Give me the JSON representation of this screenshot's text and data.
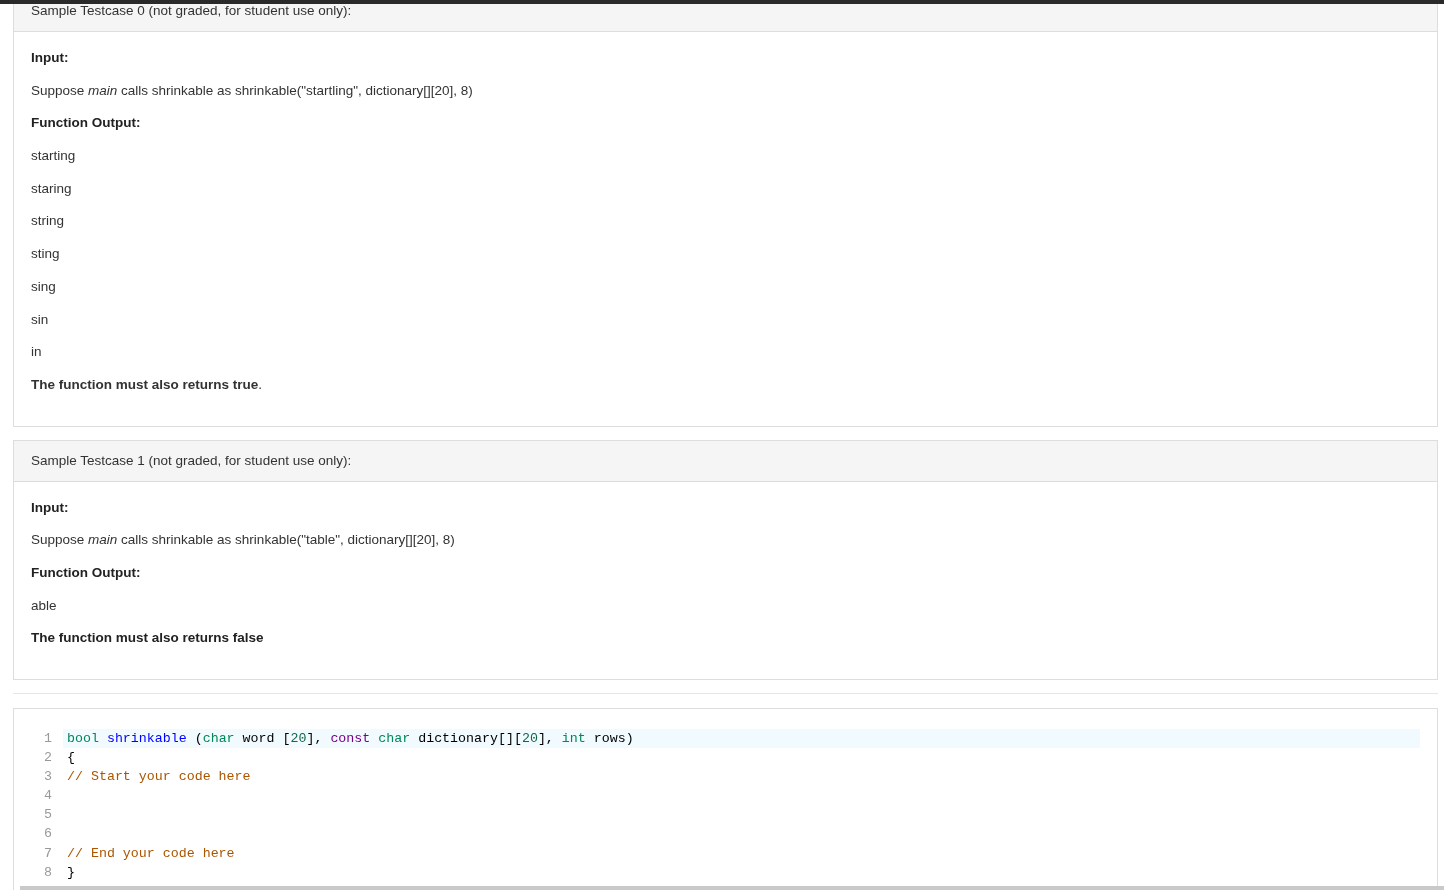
{
  "testcases": [
    {
      "title": "Sample Testcase 0 (not graded, for student use only):",
      "blocks": [
        {
          "kind": "label",
          "text": "Input:"
        },
        {
          "kind": "text",
          "text": "Suppose *main* calls shrinkable as shrinkable(\"startling\", dictionary[][20], 8)"
        },
        {
          "kind": "label",
          "text": "Function Output:"
        },
        {
          "kind": "output",
          "text": "starting"
        },
        {
          "kind": "output",
          "text": "staring"
        },
        {
          "kind": "output",
          "text": "string"
        },
        {
          "kind": "output",
          "text": "sting"
        },
        {
          "kind": "output",
          "text": "sing"
        },
        {
          "kind": "output",
          "text": "sin"
        },
        {
          "kind": "output",
          "text": "in"
        },
        {
          "kind": "text",
          "text": "**The function must also returns true**."
        }
      ]
    },
    {
      "title": "Sample Testcase 1 (not graded, for student use only):",
      "blocks": [
        {
          "kind": "label",
          "text": "Input:"
        },
        {
          "kind": "text",
          "text": "Suppose *main* calls shrinkable as shrinkable(\"table\", dictionary[][20], 8)"
        },
        {
          "kind": "label",
          "text": "Function Output:"
        },
        {
          "kind": "output",
          "text": "able"
        },
        {
          "kind": "statement",
          "text": "The function must also returns false"
        }
      ]
    }
  ],
  "code_editor": {
    "lines": [
      {
        "number": "1",
        "active": true,
        "tokens": [
          {
            "kind": "type",
            "text": "bool"
          },
          {
            "kind": "def",
            "text": " shrinkable"
          },
          {
            "kind": "plain",
            "text": " ("
          },
          {
            "kind": "type",
            "text": "char"
          },
          {
            "kind": "plain",
            "text": " word ["
          },
          {
            "kind": "number",
            "text": "20"
          },
          {
            "kind": "plain",
            "text": "], "
          },
          {
            "kind": "keyword",
            "text": "const"
          },
          {
            "kind": "type",
            "text": " char"
          },
          {
            "kind": "plain",
            "text": " dictionary[]["
          },
          {
            "kind": "number",
            "text": "20"
          },
          {
            "kind": "plain",
            "text": "], "
          },
          {
            "kind": "type",
            "text": "int"
          },
          {
            "kind": "plain",
            "text": " rows)"
          }
        ]
      },
      {
        "number": "2",
        "active": false,
        "tokens": [
          {
            "kind": "plain",
            "text": "{"
          }
        ]
      },
      {
        "number": "3",
        "active": false,
        "tokens": [
          {
            "kind": "comment",
            "text": "// Start your code here"
          }
        ]
      },
      {
        "number": "4",
        "active": false
      },
      {
        "number": "5",
        "active": false
      },
      {
        "number": "6",
        "active": false
      },
      {
        "number": "7",
        "active": false,
        "tokens": [
          {
            "kind": "comment",
            "text": "// End your code here"
          }
        ]
      },
      {
        "number": "8",
        "active": false,
        "tokens": [
          {
            "kind": "plain",
            "text": "}"
          }
        ]
      }
    ]
  }
}
